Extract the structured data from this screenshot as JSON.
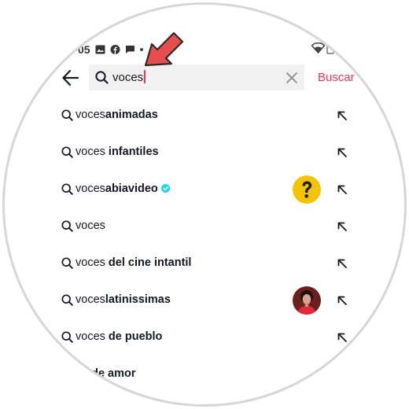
{
  "status_bar": {
    "time": "05",
    "icons": [
      "image-icon",
      "facebook-icon",
      "message-icon",
      "dot-icon",
      "wifi-icon"
    ]
  },
  "header": {
    "back_icon": "arrow-left-icon",
    "search_value": "voces",
    "clear_icon": "close-icon",
    "search_button_label": "Buscar"
  },
  "suggestions": [
    {
      "query": "voces",
      "suffix": "animadas"
    },
    {
      "query": "voces",
      "suffix": " infantiles"
    },
    {
      "query": "voces",
      "suffix": "abiavideo"
    },
    {
      "query": "voces",
      "suffix": ""
    },
    {
      "query": "voces",
      "suffix": " del cine intantil"
    },
    {
      "query": "voces",
      "suffix": "latinissimas"
    },
    {
      "query": "voces",
      "suffix": " de pueblo"
    },
    {
      "query": "",
      "suffix": "s de amor"
    }
  ],
  "colors": {
    "accent": "#fe2c55",
    "verified": "#20d5ec",
    "pointer": "#e84d4d",
    "thumb_question_bg": "#f5c400"
  }
}
